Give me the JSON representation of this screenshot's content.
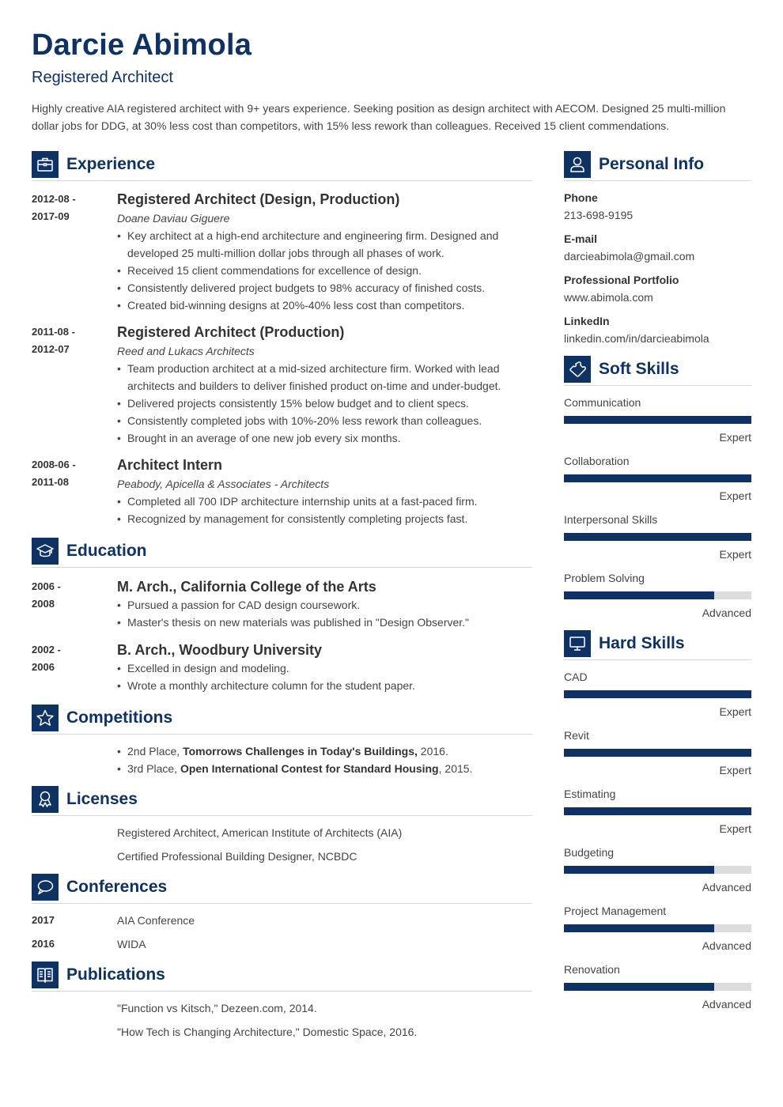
{
  "header": {
    "name": "Darcie Abimola",
    "role": "Registered Architect",
    "summary": "Highly creative AIA registered architect with 9+ years experience. Seeking position as design architect with AECOM. Designed 25 multi-million dollar jobs for DDG, at 30% less cost than competitors, with 15% less rework than colleagues. Received 15 client commendations."
  },
  "colors": {
    "accent": "#0e3263",
    "bar_empty": "#dcdcdc",
    "text": "#444444"
  },
  "experience": {
    "title": "Experience",
    "icon": "briefcase-icon",
    "jobs": [
      {
        "date_from": "2012-08 -",
        "date_to": "2017-09",
        "title": "Registered Architect (Design, Production)",
        "company": "Doane Daviau Giguere",
        "bullets": [
          "Key architect at a high-end architecture and engineering firm. Designed and developed 25 multi-million dollar jobs through all phases of work.",
          "Received 15 client commendations for excellence of design.",
          "Consistently delivered project budgets to 98% accuracy of finished costs.",
          "Created bid-winning designs at 20%-40% less cost than competitors."
        ]
      },
      {
        "date_from": "2011-08 -",
        "date_to": "2012-07",
        "title": "Registered Architect (Production)",
        "company": "Reed and Lukacs Architects",
        "bullets": [
          "Team production architect at a mid-sized architecture firm. Worked with lead architects and builders to deliver finished product on-time and under-budget.",
          "Delivered projects consistently 15% below budget and to client specs.",
          "Consistently completed jobs with 10%-20% less rework than colleagues.",
          "Brought in an average of one new job every six months."
        ]
      },
      {
        "date_from": "2008-06 -",
        "date_to": "2011-08",
        "title": "Architect Intern",
        "company": "Peabody, Apicella & Associates - Architects",
        "bullets": [
          "Completed all 700 IDP architecture internship units at a fast-paced firm.",
          "Recognized by management for consistently completing projects fast."
        ]
      }
    ]
  },
  "education": {
    "title": "Education",
    "icon": "graduation-cap-icon",
    "items": [
      {
        "date_from": "2006 -",
        "date_to": "2008",
        "title": "M. Arch., California College of the Arts",
        "bullets": [
          "Pursued a passion for CAD design coursework.",
          "Master's thesis on new materials was published in \"Design Observer.\""
        ]
      },
      {
        "date_from": "2002 -",
        "date_to": "2006",
        "title": "B. Arch., Woodbury University",
        "bullets": [
          "Excelled in design and modeling.",
          "Wrote a monthly architecture column for the student paper."
        ]
      }
    ]
  },
  "competitions": {
    "title": "Competitions",
    "icon": "star-icon",
    "items": [
      {
        "prefix": "2nd Place, ",
        "bold": "Tomorrows Challenges in Today's Buildings,",
        "suffix": " 2016."
      },
      {
        "prefix": "3rd Place, ",
        "bold": "Open International Contest for Standard Housing",
        "suffix": ", 2015."
      }
    ]
  },
  "licenses": {
    "title": "Licenses",
    "icon": "award-ribbon-icon",
    "items": [
      "Registered Architect, American Institute of Architects (AIA)",
      "Certified Professional Building Designer, NCBDC"
    ]
  },
  "conferences": {
    "title": "Conferences",
    "icon": "speech-bubble-icon",
    "items": [
      {
        "year": "2017",
        "name": "AIA Conference"
      },
      {
        "year": "2016",
        "name": "WIDA"
      }
    ]
  },
  "publications": {
    "title": "Publications",
    "icon": "book-icon",
    "items": [
      "\"Function vs Kitsch,\" Dezeen.com, 2014.",
      "\"How Tech is Changing Architecture,\" Domestic Space, 2016."
    ]
  },
  "personal_info": {
    "title": "Personal Info",
    "icon": "user-icon",
    "fields": [
      {
        "label": "Phone",
        "value": "213-698-9195"
      },
      {
        "label": "E-mail",
        "value": "darcieabimola@gmail.com"
      },
      {
        "label": "Professional Portfolio",
        "value": "www.abimola.com"
      },
      {
        "label": "LinkedIn",
        "value": "linkedin.com/in/darcieabimola"
      }
    ]
  },
  "soft_skills": {
    "title": "Soft Skills",
    "icon": "puzzle-piece-icon",
    "items": [
      {
        "name": "Communication",
        "level": "Expert",
        "fill": 1.0
      },
      {
        "name": "Collaboration",
        "level": "Expert",
        "fill": 1.0
      },
      {
        "name": "Interpersonal Skills",
        "level": "Expert",
        "fill": 1.0
      },
      {
        "name": "Problem Solving",
        "level": "Advanced",
        "fill": 0.8
      }
    ]
  },
  "hard_skills": {
    "title": "Hard Skills",
    "icon": "monitor-icon",
    "items": [
      {
        "name": "CAD",
        "level": "Expert",
        "fill": 1.0
      },
      {
        "name": "Revit",
        "level": "Expert",
        "fill": 1.0
      },
      {
        "name": "Estimating",
        "level": "Expert",
        "fill": 1.0
      },
      {
        "name": "Budgeting",
        "level": "Advanced",
        "fill": 0.8
      },
      {
        "name": "Project Management",
        "level": "Advanced",
        "fill": 0.8
      },
      {
        "name": "Renovation",
        "level": "Advanced",
        "fill": 0.8
      }
    ]
  }
}
